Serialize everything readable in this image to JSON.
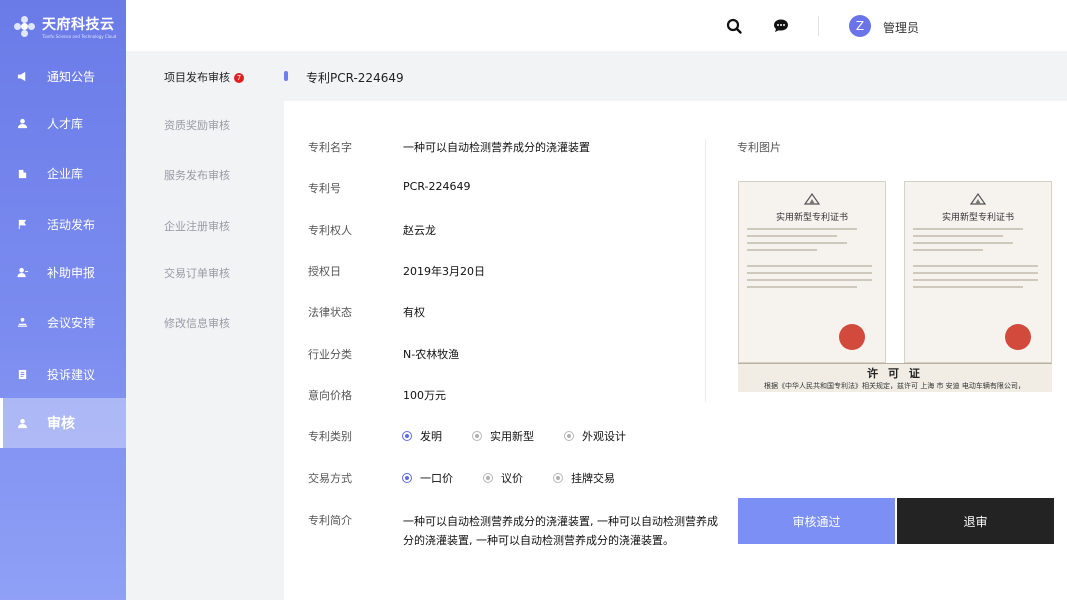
{
  "app": {
    "logo_title": "天府科技云",
    "logo_subtitle": "Tianfu Science and Technology Cloud"
  },
  "sidebar": {
    "items": [
      {
        "label": "通知公告",
        "icon": "megaphone-icon"
      },
      {
        "label": "人才库",
        "icon": "person-icon"
      },
      {
        "label": "企业库",
        "icon": "building-icon"
      },
      {
        "label": "活动发布",
        "icon": "flag-icon"
      },
      {
        "label": "补助申报",
        "icon": "user-apply-icon"
      },
      {
        "label": "会议安排",
        "icon": "meeting-icon"
      },
      {
        "label": "投诉建议",
        "icon": "document-icon"
      },
      {
        "label": "审核",
        "icon": "user-review-icon",
        "active": true
      }
    ]
  },
  "topbar": {
    "search_icon": "search-icon",
    "message_icon": "chat-icon",
    "avatar_letter": "Z",
    "username": "管理员"
  },
  "subnav": {
    "items": [
      {
        "label": "项目发布审核",
        "active": true,
        "badge": "7"
      },
      {
        "label": "资质奖励审核"
      },
      {
        "label": "服务发布审核"
      },
      {
        "label": "企业注册审核"
      },
      {
        "label": "交易订单审核"
      },
      {
        "label": "修改信息审核"
      }
    ]
  },
  "detail": {
    "title": "专利PCR-224649",
    "fields": [
      {
        "label": "专利名字",
        "value": "一种可以自动检测营养成分的浇灌装置"
      },
      {
        "label": "专利号",
        "value": "PCR-224649"
      },
      {
        "label": "专利权人",
        "value": "赵云龙"
      },
      {
        "label": "授权日",
        "value": "2019年3月20日"
      },
      {
        "label": "法律状态",
        "value": "有权"
      },
      {
        "label": "行业分类",
        "value": "N-农林牧渔"
      },
      {
        "label": "意向价格",
        "value": "100万元"
      }
    ],
    "patent_type": {
      "label": "专利类别",
      "options": [
        {
          "label": "发明",
          "selected": true
        },
        {
          "label": "实用新型",
          "selected": false
        },
        {
          "label": "外观设计",
          "selected": false
        }
      ]
    },
    "trade_method": {
      "label": "交易方式",
      "options": [
        {
          "label": "一口价",
          "selected": true
        },
        {
          "label": "议价",
          "selected": false
        },
        {
          "label": "挂牌交易",
          "selected": false
        }
      ]
    },
    "intro": {
      "label": "专利简介",
      "line1": "一种可以自动检测营养成分的浇灌装置, 一种可以自动检测营养成",
      "line2": "分的浇灌装置, 一种可以自动检测营养成分的浇灌装置。"
    },
    "images_label": "专利图片",
    "cert_heading": "实用新型专利证书",
    "license_title": "许 可 证",
    "license_text": "根据《中华人民共和国专利法》相关规定，兹许可 上海 市 安迪 电动车辆有限公司，",
    "approve_label": "审核通过",
    "reject_label": "退审"
  },
  "colors": {
    "accent": "#6a80f0",
    "sidebar_top": "#6a7be8",
    "approve_bg": "#7b8ff5",
    "reject_bg": "#232323"
  }
}
